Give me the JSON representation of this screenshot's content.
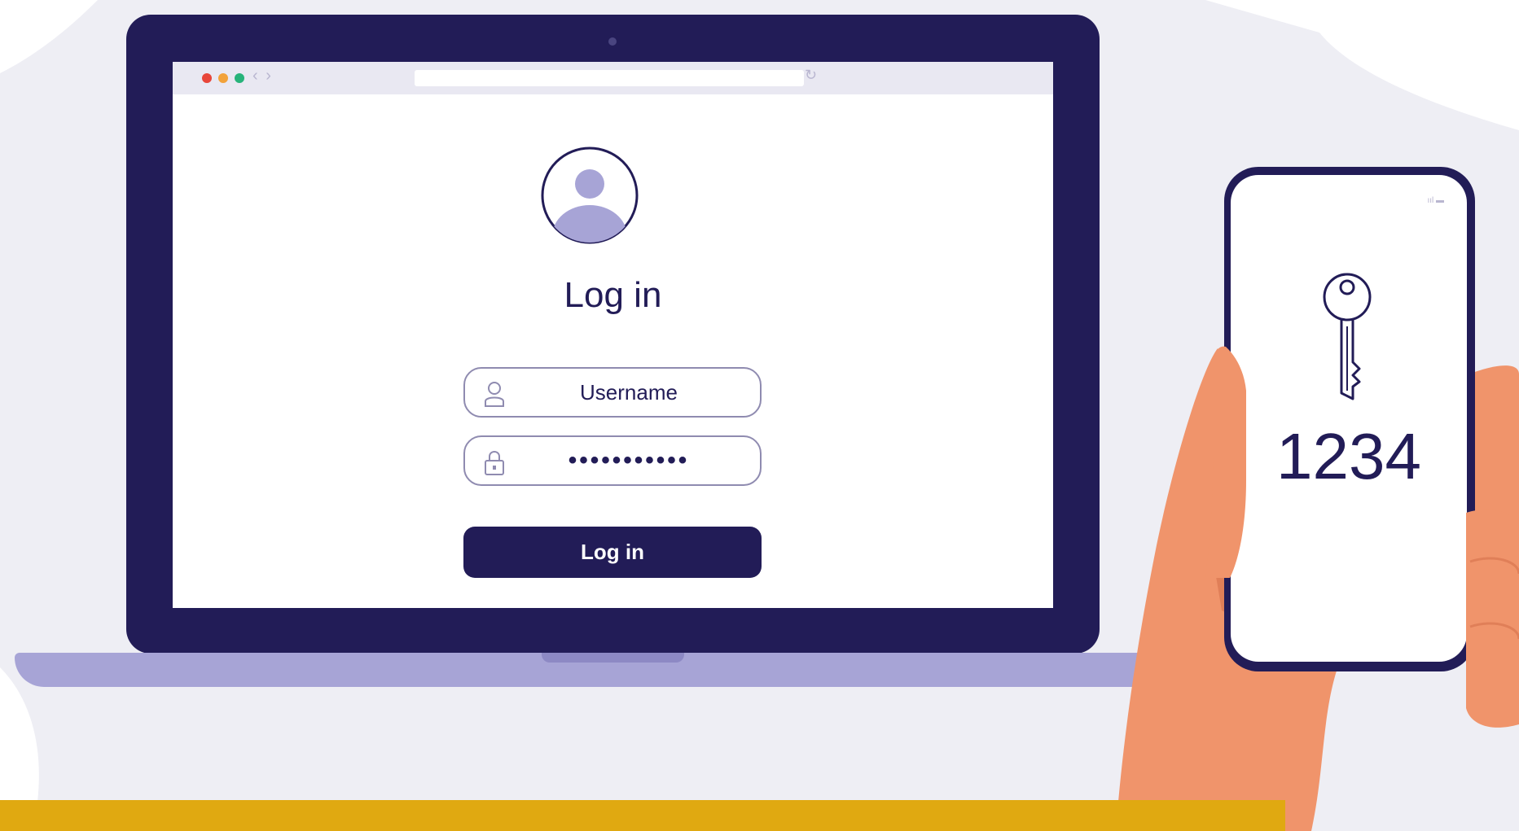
{
  "colors": {
    "navy": "#221c57",
    "lavender": "#a7a4d6",
    "skin": "#f0946b",
    "banner": "#e0a911",
    "background_shape": "#eeeef4"
  },
  "browser": {
    "nav_arrows": "‹ ›",
    "reload_icon": "↻"
  },
  "login": {
    "title": "Log in",
    "username_value": "Username",
    "password_value": "•••••••••••",
    "submit_label": "Log in"
  },
  "phone": {
    "code": "1234",
    "status": "ııl ▬"
  },
  "icons": {
    "avatar": "user-avatar-icon",
    "username": "user-outline-icon",
    "password": "lock-outline-icon",
    "phone": "key-icon"
  }
}
